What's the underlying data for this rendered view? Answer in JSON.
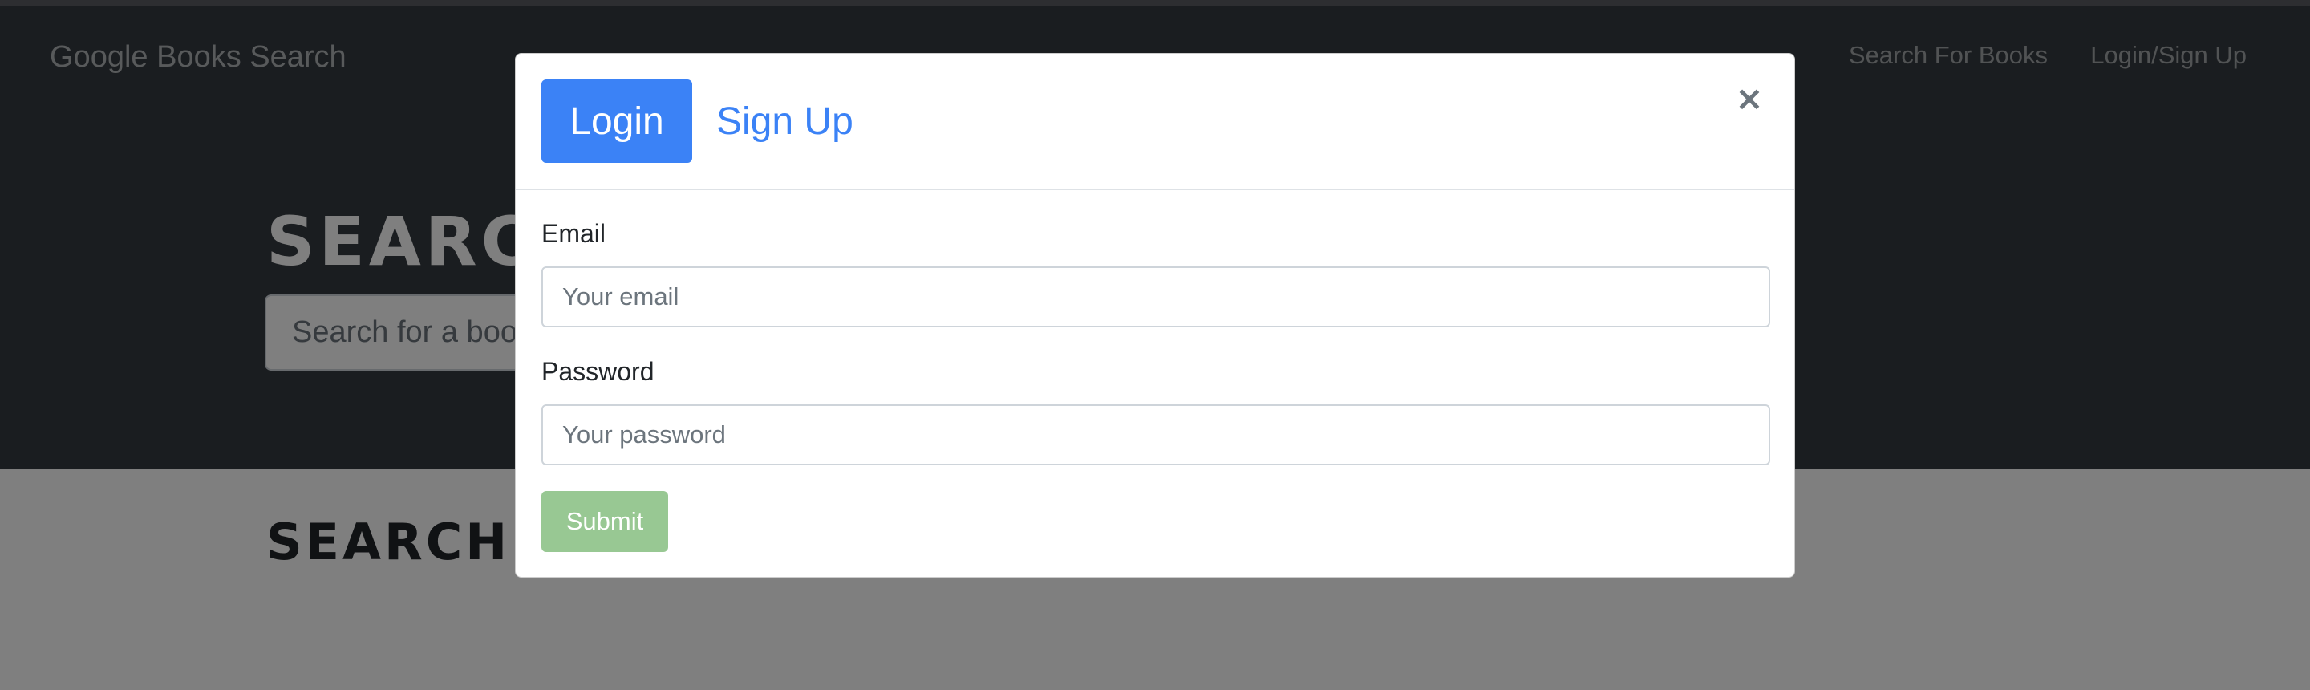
{
  "navbar": {
    "brand": "Google Books Search",
    "links": [
      "Search For Books",
      "Login/Sign Up"
    ]
  },
  "hero": {
    "title": "SEARCH FOR BOOKS!",
    "search_placeholder": "Search for a book"
  },
  "results": {
    "title": "SEARCH FOR A BOOK TO BEGIN"
  },
  "modal": {
    "tabs": [
      {
        "label": "Login",
        "active": true
      },
      {
        "label": "Sign Up",
        "active": false
      }
    ],
    "close_label": "×",
    "email_label": "Email",
    "email_placeholder": "Your email",
    "password_label": "Password",
    "password_placeholder": "Your password",
    "submit_label": "Submit"
  },
  "colors": {
    "navbar_bg": "#343a40",
    "primary": "#3b82f6",
    "submit_disabled": "#98c893",
    "backdrop": "rgba(0,0,0,0.5)"
  },
  "icons": {
    "close": "close-icon"
  }
}
